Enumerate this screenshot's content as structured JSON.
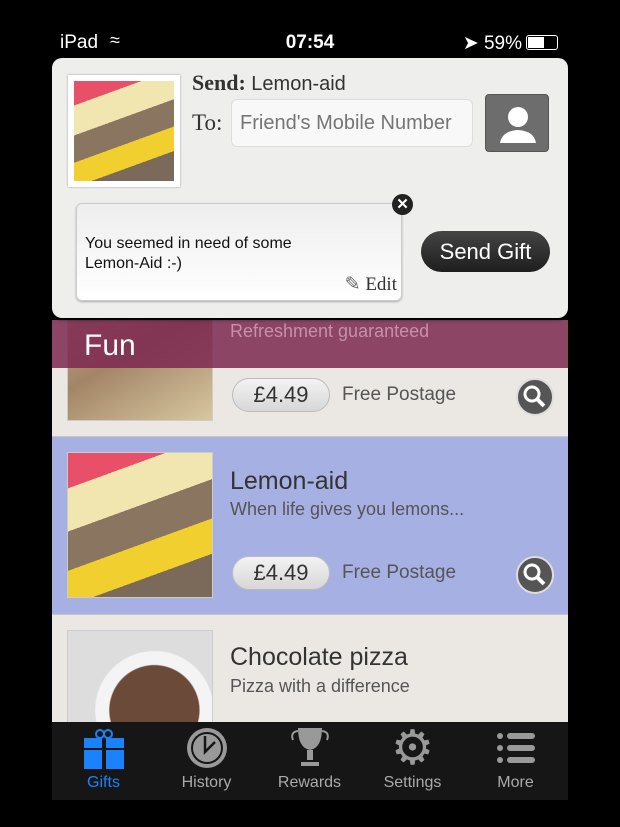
{
  "status": {
    "device": "iPad",
    "time": "07:54",
    "battery": "59%",
    "battery_level": 0.59
  },
  "compose": {
    "send_label": "Send:",
    "item": "Lemon-aid",
    "to_label": "To:",
    "to_placeholder": "Friend's Mobile Number",
    "to_value": "",
    "message": "You seemed in need of some Lemon-Aid :-)",
    "edit_label": "Edit",
    "send_button": "Send Gift"
  },
  "section": {
    "title": "Fun"
  },
  "products": [
    {
      "title": "",
      "subtitle": "Refreshment guaranteed",
      "price": "£4.49",
      "postage": "Free Postage"
    },
    {
      "title": "Lemon-aid",
      "subtitle": "When life gives you lemons...",
      "price": "£4.49",
      "postage": "Free Postage",
      "selected": true
    },
    {
      "title": "Chocolate pizza",
      "subtitle": "Pizza with a difference"
    }
  ],
  "tabs": [
    {
      "label": "Gifts",
      "icon": "gift-icon",
      "active": true
    },
    {
      "label": "History",
      "icon": "clock-icon"
    },
    {
      "label": "Rewards",
      "icon": "trophy-icon"
    },
    {
      "label": "Settings",
      "icon": "gear-icon"
    },
    {
      "label": "More",
      "icon": "list-icon"
    }
  ],
  "colors": {
    "accent": "#1a82fb",
    "section": "#86405e",
    "selected_row": "#a7b0e3"
  }
}
